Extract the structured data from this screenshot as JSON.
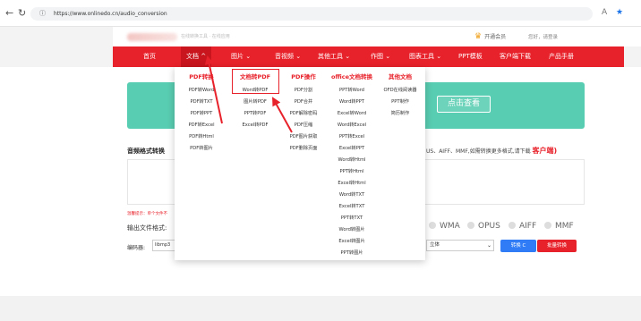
{
  "browser": {
    "back_icon": "back-arrow-icon",
    "reload_icon": "reload-icon",
    "url": "https://www.onlinedo.cn/audio_conversion",
    "icons": [
      "info-icon",
      "read-aloud-icon",
      "favorite-star-icon"
    ]
  },
  "topbar": {
    "site_sub": "在线转换工具 · 在线应用",
    "vip": "开通会员",
    "login": "您好，请登录"
  },
  "nav": {
    "items": [
      "首页",
      "文档",
      "图片",
      "音视频",
      "其他工具",
      "作图",
      "图表工具",
      "PPT模板",
      "客户端下载",
      "产品手册"
    ],
    "open_item": "文档"
  },
  "dropdown": {
    "columns": [
      {
        "title": "PDF转换",
        "items": [
          "PDF转Word",
          "PDF转TXT",
          "PDF转PPT",
          "PDF转Excel",
          "PDF转Html",
          "PDF转图片"
        ]
      },
      {
        "title": "文档转PDF",
        "items": [
          "Word转PDF",
          "图片转PDF",
          "PPT转PDF",
          "Excel转PDF"
        ]
      },
      {
        "title": "PDF操作",
        "items": [
          "PDF分割",
          "PDF合并",
          "PDF解除密码",
          "PDF压缩",
          "PDF图片获取",
          "PDF删除页面"
        ]
      },
      {
        "title": "office文档转换",
        "items": [
          "PPT转Word",
          "Word转PPT",
          "Excel转Word",
          "Word转Excel",
          "PPT转Excel",
          "Excel转PPT",
          "Word转Html",
          "PPT转Html",
          "Excel转Html",
          "Word转TXT",
          "Excel转TXT",
          "PPT转TXT",
          "Word转图片",
          "Excel转图片",
          "PPT转图片"
        ]
      },
      {
        "title": "其他文档",
        "items": [
          "OFD在线阅读器",
          "PPT制作",
          "简历制作"
        ]
      }
    ]
  },
  "banner": {
    "button": "点击查看"
  },
  "converter": {
    "title": "音频格式转换",
    "formats_note": "US、AIFF、MMF,如需转换更多格式,请下载",
    "client_link": "客户端)",
    "tip": "温馨提示：单个文件不",
    "output_label": "输出文件格式:",
    "formats": [
      "WMA",
      "OPUS",
      "AIFF",
      "MMF"
    ],
    "encoding_label": "编码器:",
    "encoding_value": "libmp3",
    "charset_value": "立体",
    "convert_label": "转换 C",
    "batch_label": "批量转换"
  },
  "colors": {
    "brand_red": "#e8222b",
    "banner_teal": "#59cdb1",
    "convert_blue": "#2f7cf6"
  }
}
